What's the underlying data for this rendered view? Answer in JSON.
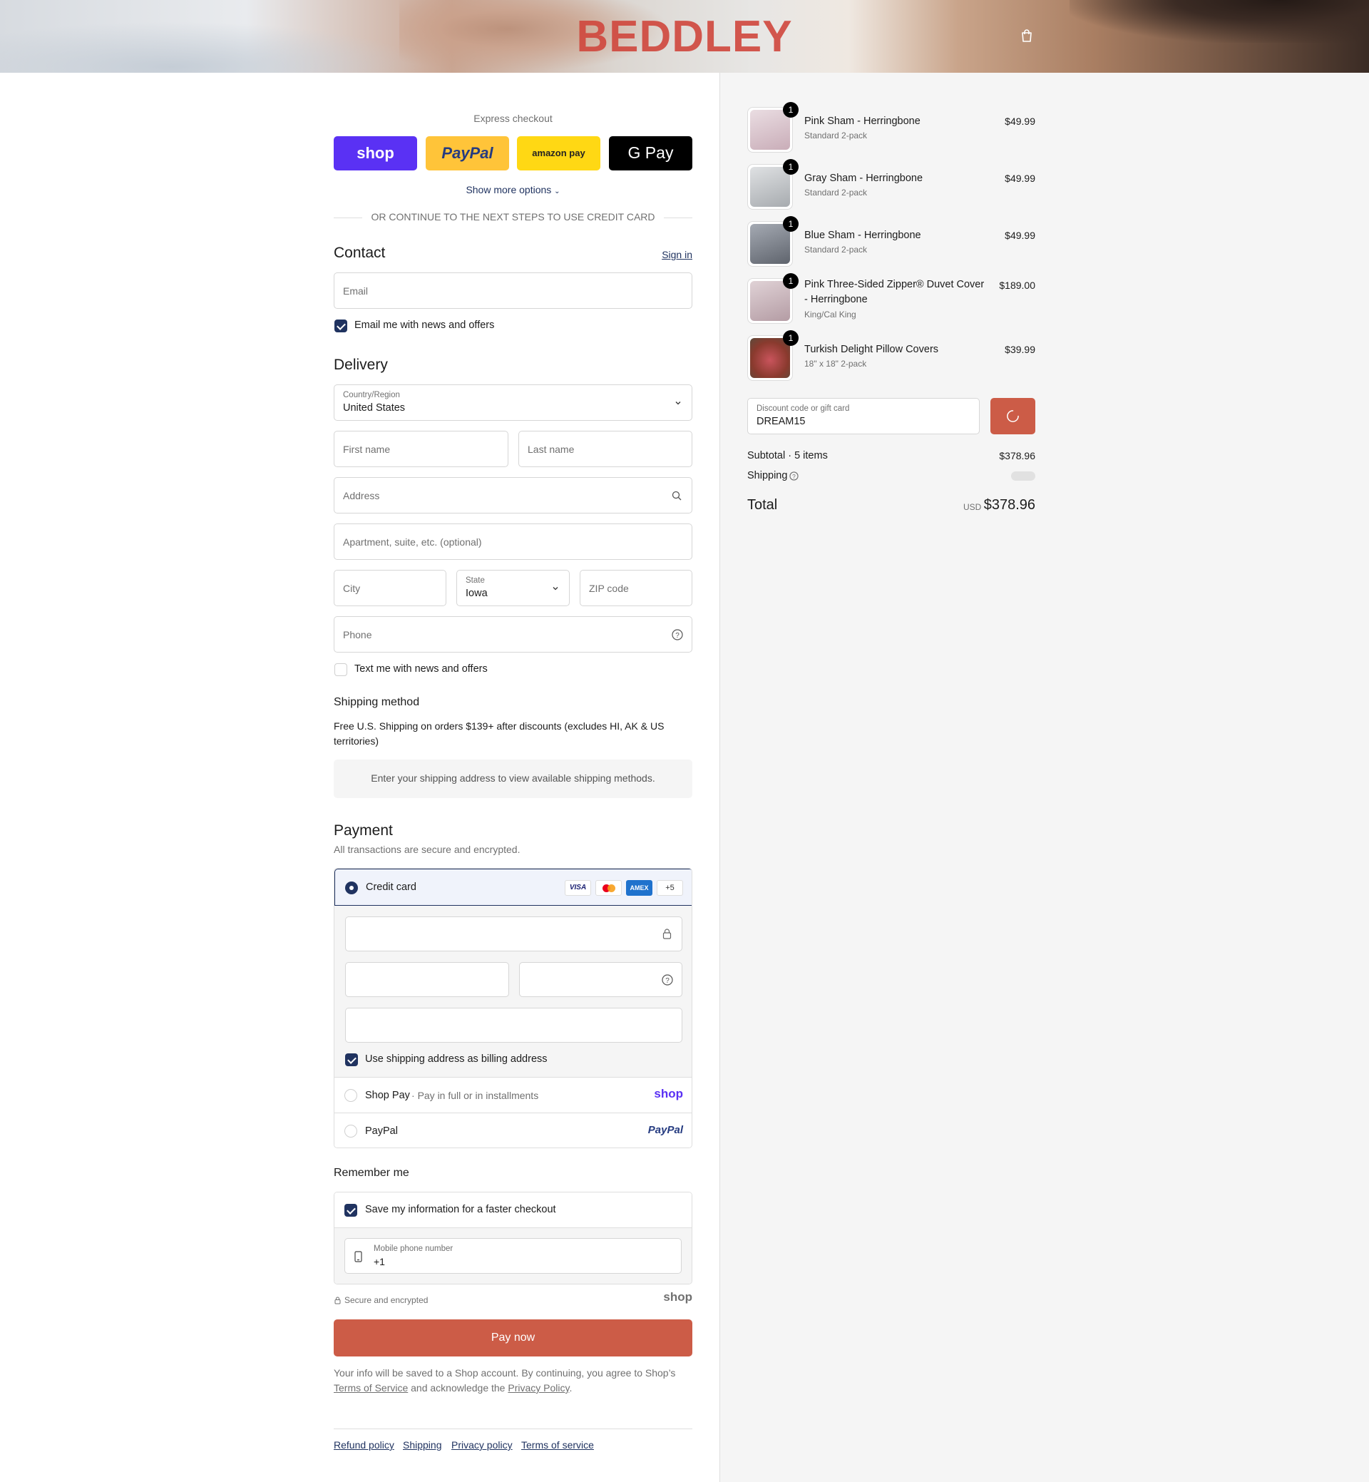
{
  "header": {
    "logo": "BEDDLEY"
  },
  "express": {
    "title": "Express checkout",
    "buttons": [
      "shop",
      "PayPal",
      "amazon pay",
      "G Pay"
    ],
    "show_more": "Show more options",
    "divider": "OR CONTINUE TO THE NEXT STEPS TO USE CREDIT CARD"
  },
  "contact": {
    "title": "Contact",
    "sign_in": "Sign in",
    "email_placeholder": "Email",
    "news_label": "Email me with news and offers"
  },
  "delivery": {
    "title": "Delivery",
    "country_label": "Country/Region",
    "country_value": "United States",
    "first_name": "First name",
    "last_name": "Last name",
    "address": "Address",
    "apartment": "Apartment, suite, etc. (optional)",
    "city": "City",
    "state_label": "State",
    "state_value": "Iowa",
    "zip": "ZIP code",
    "phone": "Phone",
    "text_label": "Text me with news and offers"
  },
  "shipping_method": {
    "title": "Shipping method",
    "note": "Free U.S. Shipping on orders $139+ after discounts (excludes HI, AK & US territories)",
    "placeholder": "Enter your shipping address to view available shipping methods."
  },
  "payment": {
    "title": "Payment",
    "subtitle": "All transactions are secure and encrypted.",
    "credit_card": "Credit card",
    "card_brands": [
      "VISA",
      "mastercard",
      "AMEX",
      "+5"
    ],
    "billing_label": "Use shipping address as billing address",
    "shop_pay": "Shop Pay",
    "shop_pay_sub": "Pay in full or in installments",
    "shop_pay_logo": "shop",
    "paypal": "PayPal",
    "paypal_logo": "PayPal"
  },
  "remember": {
    "title": "Remember me",
    "save_label": "Save my information for a faster checkout",
    "mobile_label": "Mobile phone number",
    "mobile_value": "+1",
    "secure": "Secure and encrypted",
    "shop_logo": "shop"
  },
  "pay_now": "Pay now",
  "legal": {
    "text1": "Your info will be saved to a Shop account. By continuing, you agree to Shop’s",
    "terms": "Terms of Service",
    "text2": "and acknowledge the",
    "privacy": "Privacy Policy",
    "end": "."
  },
  "footer": [
    "Refund policy",
    "Shipping",
    "Privacy policy",
    "Terms of service"
  ],
  "cart": {
    "items": [
      {
        "title": "Pink Sham - Herringbone",
        "sub": "Standard 2-pack",
        "price": "$49.99",
        "qty": "1",
        "color": "#d9c6cd"
      },
      {
        "title": "Gray Sham - Herringbone",
        "sub": "Standard 2-pack",
        "price": "$49.99",
        "qty": "1",
        "color": "#b9bcbf"
      },
      {
        "title": "Blue Sham - Herringbone",
        "sub": "Standard 2-pack",
        "price": "$49.99",
        "qty": "1",
        "color": "#7c818b"
      },
      {
        "title": "Pink Three-Sided Zipper® Duvet Cover - Herringbone",
        "sub": "King/Cal King",
        "price": "$189.00",
        "qty": "1",
        "color": "#c7aeb5"
      },
      {
        "title": "Turkish Delight Pillow Covers",
        "sub": "18\" x 18\" 2-pack",
        "price": "$39.99",
        "qty": "1",
        "color": "#b24a50"
      }
    ],
    "discount_label": "Discount code or gift card",
    "discount_value": "DREAM15",
    "subtotal_label": "Subtotal · 5 items",
    "subtotal_value": "$378.96",
    "shipping_label": "Shipping",
    "total_label": "Total",
    "currency": "USD",
    "total_value": "$378.96"
  },
  "colors": {
    "accent": "#cc5c47",
    "navy": "#203360",
    "shop_purple": "#5a31f4"
  }
}
